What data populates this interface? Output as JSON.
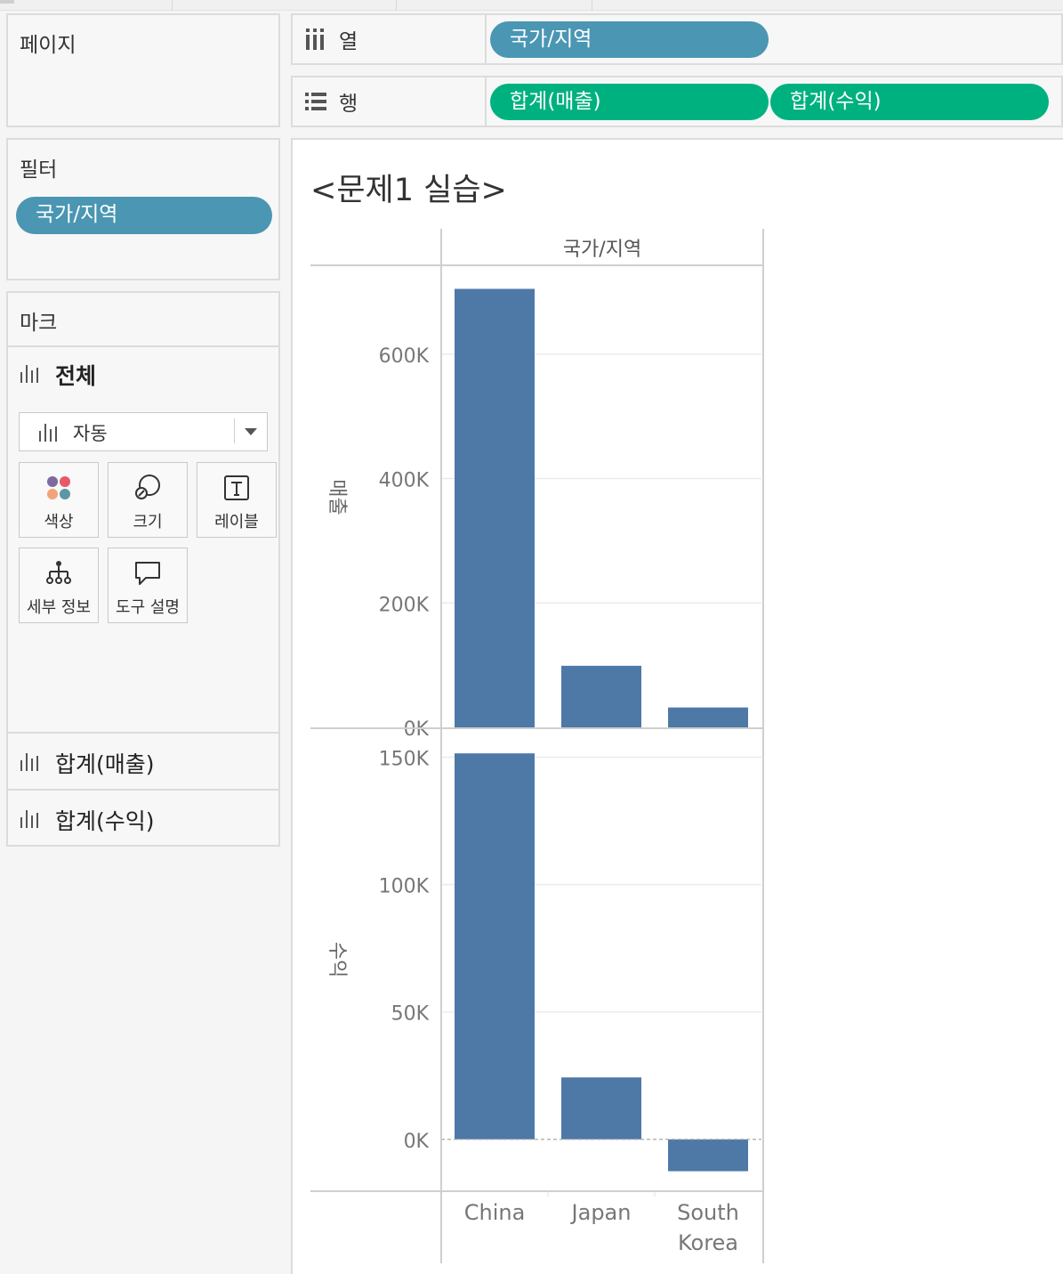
{
  "pages_card": {
    "title": "페이지"
  },
  "filters_card": {
    "title": "필터",
    "pills": [
      "국가/지역"
    ]
  },
  "marks_card": {
    "title": "마크",
    "all_label": "전체",
    "mark_type": "자동",
    "buttons": {
      "color": "색상",
      "size": "크기",
      "label": "레이블",
      "detail": "세부 정보",
      "tooltip": "도구 설명"
    },
    "measure_rows": [
      "합계(매출)",
      "합계(수익)"
    ]
  },
  "columns_shelf": {
    "label": "열",
    "pills": [
      "국가/지역"
    ]
  },
  "rows_shelf": {
    "label": "행",
    "pills": [
      "합계(매출)",
      "합계(수익)"
    ]
  },
  "colors": {
    "dimension_pill": "#4a96b3",
    "measure_pill": "#00b180",
    "bar": "#4e79a7"
  },
  "sheet": {
    "title": "<문제1 실습>"
  },
  "chart_data": {
    "type": "bar",
    "column_header": "국가/지역",
    "categories": [
      "China",
      "Japan",
      "South Korea"
    ],
    "category_lines": [
      [
        "China"
      ],
      [
        "Japan"
      ],
      [
        "South",
        "Korea"
      ]
    ],
    "series": [
      {
        "name": "매출",
        "values": [
          705000,
          99000,
          32000
        ],
        "ylim": [
          0,
          740000
        ],
        "ticks": [
          0,
          200000,
          400000,
          600000
        ],
        "tick_labels": [
          "0K",
          "200K",
          "400K",
          "600K"
        ]
      },
      {
        "name": "수익",
        "values": [
          151500,
          24300,
          -12500
        ],
        "ylim": [
          -20000,
          161000
        ],
        "ticks": [
          0,
          50000,
          100000,
          150000
        ],
        "tick_labels": [
          "0K",
          "50K",
          "100K",
          "150K"
        ]
      }
    ],
    "grid": true
  }
}
